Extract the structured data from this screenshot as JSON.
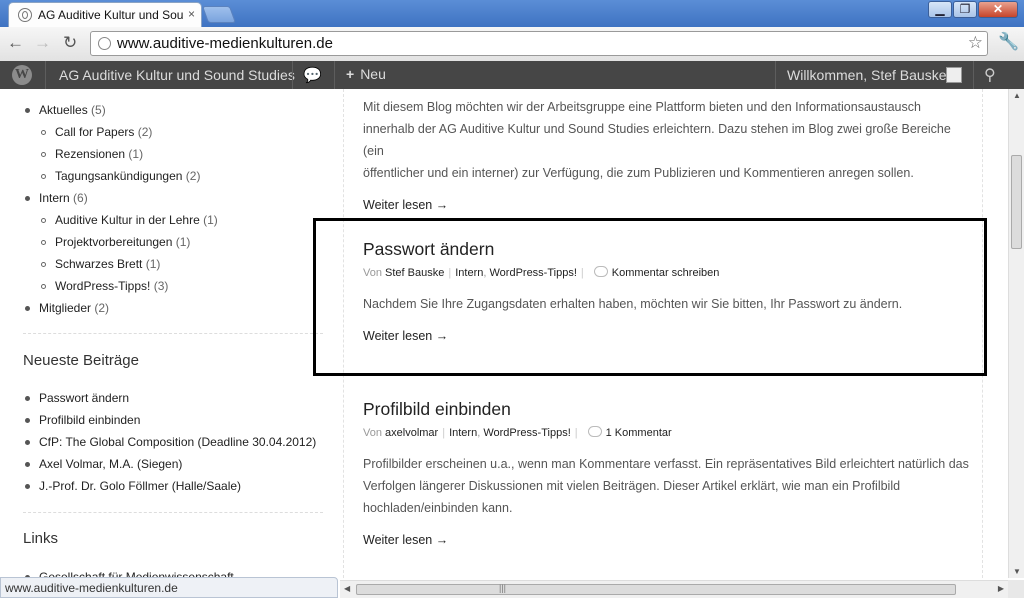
{
  "browser": {
    "tab_title": "AG Auditive Kultur und Sou",
    "tab_close": "×",
    "url": "www.auditive-medienkulturen.de",
    "status_url": "www.auditive-medienkulturen.de",
    "icons": {
      "back": "←",
      "forward": "→",
      "reload": "↻",
      "star": "☆",
      "wrench": "🔧",
      "minimize": "▁",
      "maximize": "❐",
      "close": "✕"
    }
  },
  "adminbar": {
    "logo": "W",
    "site_name": "AG Auditive Kultur und Sound Studies",
    "comments_icon": "💬",
    "new_plus": "+",
    "new_label": "Neu",
    "howdy": "Willkommen, Stef Bauske",
    "search_icon": "⚲"
  },
  "sidebar": {
    "categories": [
      {
        "label": "Aktuelles",
        "count": "(5)",
        "level": 0
      },
      {
        "label": "Call for Papers",
        "count": "(2)",
        "level": 1
      },
      {
        "label": "Rezensionen",
        "count": "(1)",
        "level": 1
      },
      {
        "label": "Tagungsankündigungen",
        "count": "(2)",
        "level": 1
      },
      {
        "label": "Intern",
        "count": "(6)",
        "level": 0
      },
      {
        "label": "Auditive Kultur in der Lehre",
        "count": "(1)",
        "level": 1
      },
      {
        "label": "Projektvorbereitungen",
        "count": "(1)",
        "level": 1
      },
      {
        "label": "Schwarzes Brett",
        "count": "(1)",
        "level": 1
      },
      {
        "label": "WordPress-Tipps!",
        "count": "(3)",
        "level": 1
      },
      {
        "label": "Mitglieder",
        "count": "(2)",
        "level": 0
      }
    ],
    "recent_title": "Neueste Beiträge",
    "recent_posts": [
      "Passwort ändern",
      "Profilbild einbinden",
      "CfP: The Global Composition (Deadline 30.04.2012)",
      "Axel Volmar, M.A. (Siegen)",
      "J.-Prof. Dr. Golo Föllmer (Halle/Saale)"
    ],
    "links_title": "Links",
    "links": [
      "Gesellschaft für Medienwissenschaft"
    ]
  },
  "posts": [
    {
      "excerpt_lines": [
        "Mit diesem Blog möchten wir der Arbeitsgruppe eine Plattform bieten und den Informationsaustausch",
        "innerhalb der AG Auditive Kultur und Sound Studies erleichtern. Dazu stehen im Blog zwei große Bereiche (ein",
        "öffentlicher und ein interner) zur Verfügung, die zum Publizieren und Kommentieren anregen sollen."
      ],
      "more": "Weiter lesen →"
    },
    {
      "title": "Passwort ändern",
      "by": "Von",
      "author": "Stef Bauske",
      "cat1": "Intern",
      "comma": ",",
      "cat2": "WordPress-Tipps!",
      "comments": "Kommentar schreiben",
      "excerpt_lines": [
        "Nachdem Sie Ihre Zugangsdaten erhalten haben, möchten wir Sie bitten, Ihr Passwort zu ändern."
      ],
      "more": "Weiter lesen →"
    },
    {
      "title": "Profilbild einbinden",
      "by": "Von",
      "author": "axelvolmar",
      "cat1": "Intern",
      "comma": ",",
      "cat2": "WordPress-Tipps!",
      "comments": "1 Kommentar",
      "excerpt_lines": [
        "Profilbilder erscheinen u.a., wenn man Kommentare verfasst. Ein repräsentatives Bild erleichtert natürlich das",
        "Verfolgen längerer Diskussionen mit vielen Beiträgen. Dieser Artikel erklärt, wie man ein Profilbild",
        "hochladen/einbinden kann."
      ],
      "more": "Weiter lesen →"
    }
  ],
  "scroll": {
    "up": "▲",
    "down": "▼",
    "left": "◀",
    "right": "▶",
    "grip": "|||"
  }
}
